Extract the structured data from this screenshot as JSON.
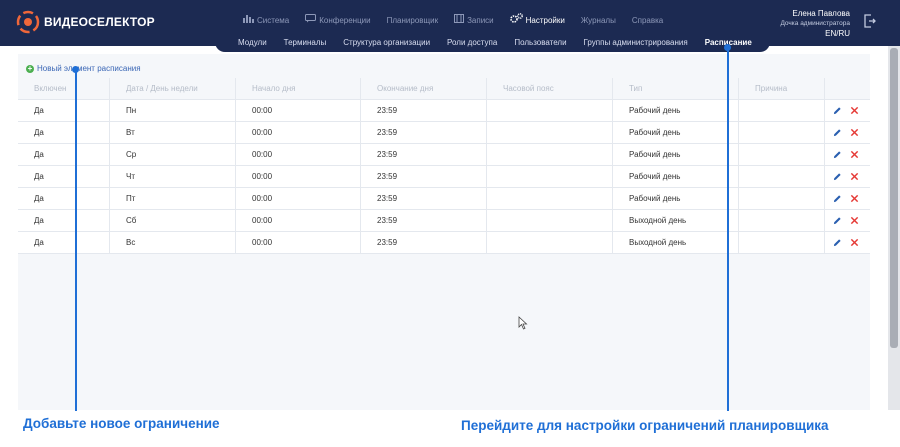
{
  "brand": {
    "name": "ВИДЕОСЕЛЕКТОР"
  },
  "top_nav": [
    {
      "label": "Система",
      "icon": "bar-chart-icon",
      "active": false
    },
    {
      "label": "Конференции",
      "icon": "chat-icon",
      "active": false
    },
    {
      "label": "Планировщик",
      "icon": "",
      "active": false
    },
    {
      "label": "Записи",
      "icon": "film-icon",
      "active": false
    },
    {
      "label": "Настройки",
      "icon": "gears-icon",
      "active": true
    },
    {
      "label": "Журналы",
      "icon": "",
      "active": false
    },
    {
      "label": "Справка",
      "icon": "",
      "active": false
    }
  ],
  "user": {
    "name": "Елена Павлова",
    "role": "Дочка администратора",
    "lang": "EN/RU"
  },
  "sub_nav": [
    {
      "label": "Модули",
      "active": false
    },
    {
      "label": "Терминалы",
      "active": false
    },
    {
      "label": "Структура организации",
      "active": false
    },
    {
      "label": "Роли доступа",
      "active": false
    },
    {
      "label": "Пользователи",
      "active": false
    },
    {
      "label": "Группы администрирования",
      "active": false
    },
    {
      "label": "Расписание",
      "active": true
    }
  ],
  "new_item_label": "Новый элемент расписания",
  "table": {
    "headers": [
      "Включен",
      "Дата / День недели",
      "Начало дня",
      "Окончание дня",
      "Часовой пояс",
      "Тип",
      "Причина",
      ""
    ],
    "rows": [
      [
        "Да",
        "Пн",
        "00:00",
        "23:59",
        "",
        "Рабочий день",
        ""
      ],
      [
        "Да",
        "Вт",
        "00:00",
        "23:59",
        "",
        "Рабочий день",
        ""
      ],
      [
        "Да",
        "Ср",
        "00:00",
        "23:59",
        "",
        "Рабочий день",
        ""
      ],
      [
        "Да",
        "Чт",
        "00:00",
        "23:59",
        "",
        "Рабочий день",
        ""
      ],
      [
        "Да",
        "Пт",
        "00:00",
        "23:59",
        "",
        "Рабочий день",
        ""
      ],
      [
        "Да",
        "Сб",
        "00:00",
        "23:59",
        "",
        "Выходной день",
        ""
      ],
      [
        "Да",
        "Вс",
        "00:00",
        "23:59",
        "",
        "Выходной день",
        ""
      ]
    ]
  },
  "captions": {
    "left": "Добавьте новое ограничение",
    "right": "Перейдите для настройки ограничений планировщика"
  },
  "colors": {
    "header_bg": "#1c2a52",
    "accent": "#1f6fd6",
    "add_green": "#4caf50",
    "delete_red": "#e53935"
  }
}
